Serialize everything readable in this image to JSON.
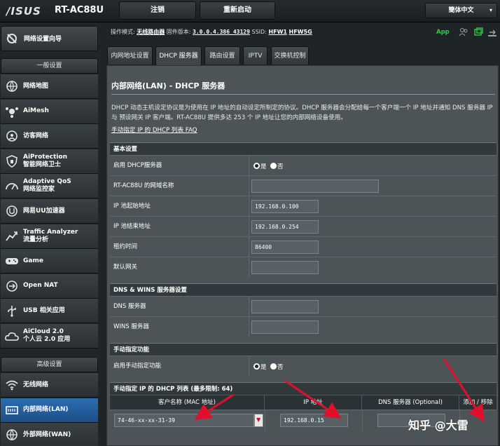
{
  "header": {
    "brand": "/ISUS",
    "model": "RT-AC88U",
    "logout": "注销",
    "reboot": "重新启动",
    "language": "簡体中文"
  },
  "sidebar": {
    "wizard": "网络设置向导",
    "general_title": "一般设置",
    "general_items": [
      {
        "label": "网络地图",
        "sub": "",
        "icon": "globe-icon"
      },
      {
        "label": "AiMesh",
        "sub": "",
        "icon": "mesh-icon"
      },
      {
        "label": "访客网络",
        "sub": "",
        "icon": "guest-globe-icon"
      },
      {
        "label": "AiProtection",
        "sub": "智能网络卫士",
        "icon": "shield-icon"
      },
      {
        "label": "Adaptive QoS",
        "sub": "网络监控家",
        "icon": "speedometer-icon"
      },
      {
        "label": "网易UU加速器",
        "sub": "",
        "icon": "accelerator-icon"
      },
      {
        "label": "Traffic Analyzer",
        "sub": "流量分析",
        "icon": "traffic-icon"
      },
      {
        "label": "Game",
        "sub": "",
        "icon": "gamepad-icon"
      },
      {
        "label": "Open NAT",
        "sub": "",
        "icon": "open-nat-icon"
      },
      {
        "label": "USB 相关应用",
        "sub": "",
        "icon": "usb-icon"
      },
      {
        "label": "AiCloud 2.0",
        "sub": "个人云 2.0 应用",
        "icon": "cloud-icon"
      }
    ],
    "advanced_title": "高级设置",
    "advanced_items": [
      {
        "label": "无线网络",
        "icon": "wifi-icon"
      },
      {
        "label": "内部网络(LAN)",
        "icon": "lan-icon"
      },
      {
        "label": "外部网络(WAN)",
        "icon": "wan-icon"
      }
    ]
  },
  "status": {
    "mode_label": "操作模式:",
    "mode_value": "无线路由器",
    "fw_label": "固件版本:",
    "fw_value": "3.0.0.4.386_43129",
    "ssid_label": "SSID:",
    "ssid_1": "HFW1",
    "ssid_2": "HFW5G",
    "app": "App"
  },
  "tabs": [
    "内网地址设置",
    "DHCP 服务器",
    "路由设置",
    "IPTV",
    "交换机控制"
  ],
  "page": {
    "title": "内部网络(LAN) - DHCP 服务器",
    "desc": "DHCP 动态主机设定协议是为使用在 IP 地址的自动设定所制定的协议。DHCP 服务器会分配给每一个客户端一个 IP 地址并通知 DNS 服务器 IP 与 预设网关 IP 客户端。RT-AC88U 提供多达 253 个 IP 地址让您的内部网络设备使用。",
    "faq": "手动指定 IP 的 DHCP 列表 FAQ"
  },
  "basic": {
    "title": "基本设置",
    "enable_label": "启用 DHCP服务器",
    "yes": "是",
    "no": "否",
    "domain_label": "RT-AC88U 的网域名称",
    "domain_value": "",
    "start_label": "IP 池起始地址",
    "start_value": "192.168.0.100",
    "end_label": "IP 池结束地址",
    "end_value": "192.168.0.254",
    "lease_label": "租约时间",
    "lease_value": "86400",
    "gateway_label": "默认网关",
    "gateway_value": ""
  },
  "dns": {
    "title": "DNS & WINS 服务器设置",
    "dns_label": "DNS 服务器",
    "dns_value": "",
    "wins_label": "WINS 服务器",
    "wins_value": ""
  },
  "manual": {
    "title": "手动指定功能",
    "enable_label": "启用手动指定功能",
    "yes": "是",
    "no": "否"
  },
  "list": {
    "title": "手动指定 IP 的 DHCP 列表 (最多限制: 64)",
    "columns": [
      "客户名称 (MAC 地址)",
      "IP 地址",
      "DNS 服务器 (Optional)",
      "添加 / 移除"
    ],
    "mac_value": "74-46-xx-xx-31-39",
    "ip_value": "192.168.0.15",
    "dns_value": ""
  },
  "watermark": "知乎 @大雷",
  "colors": {
    "accent": "#2b6db3",
    "annotation": "#e0102a",
    "panel": "#4d5458"
  }
}
